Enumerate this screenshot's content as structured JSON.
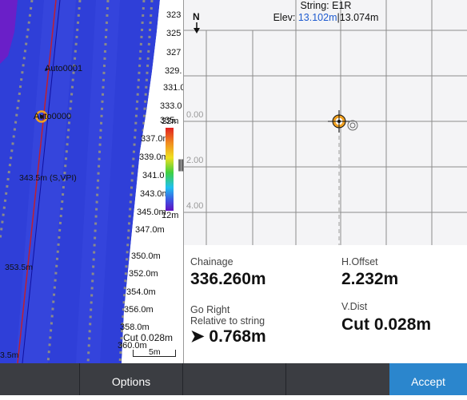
{
  "map": {
    "point_labels": [
      "Auto0001",
      "Auto0000"
    ],
    "offset_note": "343.5m (S,VPI)",
    "left_chainages": [
      "353.5m",
      "3.5m"
    ],
    "chainage_labels": [
      "323",
      "325",
      "327",
      "329.",
      "331.0",
      "333.0",
      "335.",
      "337.0m",
      "339.0m",
      "341.0",
      "343.0m",
      "345.0m",
      "347.0m",
      "350.0m",
      "352.0m",
      "354.0m",
      "356.0m",
      "358.0m",
      "360.0m"
    ],
    "legend_top": "22m",
    "legend_bottom": "12m",
    "cut_label": "Cut 0.028m",
    "scale_label": "5m",
    "handle_glyph": "|||"
  },
  "cross_section": {
    "string_label": "String: E1R",
    "elev_prefix": "Elev: ",
    "elev_design": "13.102m",
    "elev_separator": "|",
    "elev_actual": "13.074m",
    "north_label": "N",
    "y_ticks": [
      "0.00",
      "2.00",
      "4.00"
    ]
  },
  "readouts": {
    "chainage_label": "Chainage",
    "chainage_value": "336.260m",
    "hoffset_label": "H.Offset",
    "hoffset_value": "2.232m",
    "direction_label": "Go Right",
    "relative_label": "Relative to string",
    "direction_value": "➤ 0.768m",
    "vdist_label": "V.Dist",
    "vdist_value": "Cut 0.028m"
  },
  "bottom_bar": {
    "options_label": "Options",
    "accept_label": "Accept"
  },
  "colors": {
    "surface_blue": "#2f3fd8",
    "surface_purple": "#6a1fc8",
    "accent_blue": "#2b86cd",
    "target_orange": "#f0a020",
    "elev_blue": "#1e5bd0"
  }
}
